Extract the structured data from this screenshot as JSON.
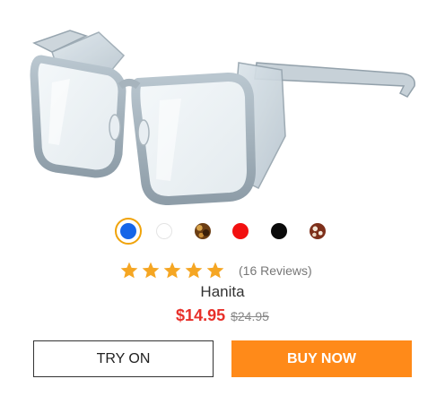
{
  "product": {
    "image_alt": "clear safety glasses with side shields",
    "name": "Hanita",
    "rating": 5,
    "rating_max": 5,
    "reviews_label": "(16 Reviews)",
    "price_sale": "$14.95",
    "price_original": "$24.95"
  },
  "swatches": [
    {
      "name": "blue",
      "color": "#1565e8",
      "selected": true
    },
    {
      "name": "white",
      "color": "#ffffff",
      "selected": false
    },
    {
      "name": "tortoise",
      "color": "#7a4a1a",
      "selected": false
    },
    {
      "name": "red",
      "color": "#f21010",
      "selected": false
    },
    {
      "name": "black",
      "color": "#0a0a0a",
      "selected": false
    },
    {
      "name": "brown-tortoise",
      "color": "#8a3a1e",
      "selected": false
    }
  ],
  "colors": {
    "star": "#f5a623",
    "sale_price": "#e8302a",
    "buy_button": "#ff8a19",
    "selected_ring": "#f0a30a"
  },
  "buttons": {
    "try_on": "TRY ON",
    "buy_now": "BUY NOW"
  }
}
